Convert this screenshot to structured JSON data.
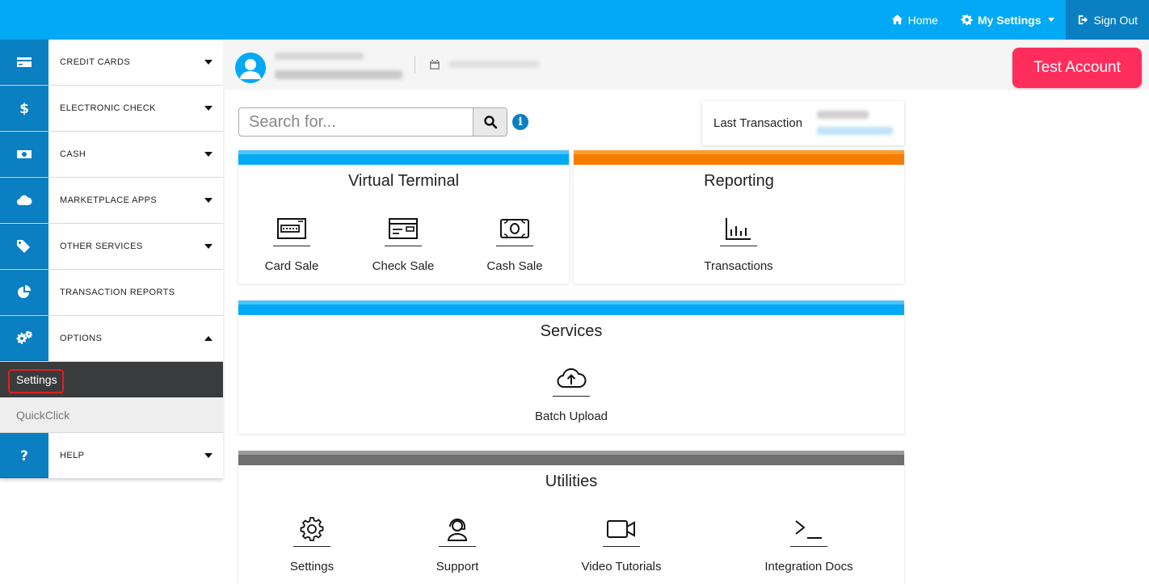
{
  "topnav": {
    "home": "Home",
    "my_settings": "My Settings",
    "sign_out": "Sign Out"
  },
  "sidebar": {
    "items": [
      {
        "label": "CREDIT CARDS",
        "icon": "credit-card-icon",
        "caret": "down"
      },
      {
        "label": "ELECTRONIC CHECK",
        "icon": "dollar-icon",
        "caret": "down"
      },
      {
        "label": "CASH",
        "icon": "cash-icon",
        "caret": "down"
      },
      {
        "label": "MARKETPLACE APPS",
        "icon": "cloud-icon",
        "caret": "down"
      },
      {
        "label": "OTHER SERVICES",
        "icon": "tags-icon",
        "caret": "down"
      },
      {
        "label": "TRANSACTION REPORTS",
        "icon": "pie-chart-icon",
        "caret": ""
      },
      {
        "label": "OPTIONS",
        "icon": "gears-icon",
        "caret": "up"
      }
    ],
    "sub_items": [
      "Settings",
      "QuickClick"
    ],
    "help": "HELP"
  },
  "test_account": "Test Account",
  "search": {
    "placeholder": "Search for..."
  },
  "info_icon": "i",
  "last_transaction": {
    "label": "Last Transaction"
  },
  "virtual_terminal": {
    "title": "Virtual Terminal",
    "tiles": [
      "Card Sale",
      "Check Sale",
      "Cash Sale"
    ]
  },
  "reporting": {
    "title": "Reporting",
    "tiles": [
      "Transactions"
    ]
  },
  "services": {
    "title": "Services",
    "tiles": [
      "Batch Upload"
    ]
  },
  "utilities": {
    "title": "Utilities",
    "tiles": [
      "Settings",
      "Support",
      "Video Tutorials",
      "Integration Docs"
    ]
  },
  "colors": {
    "primary": "#03a9f4",
    "sidebar_icon_bg": "#0a7fc2",
    "accent_pink": "#ff2d5c",
    "reporting_orange": "#f57c00",
    "utilities_gray": "#6f6f6f"
  }
}
